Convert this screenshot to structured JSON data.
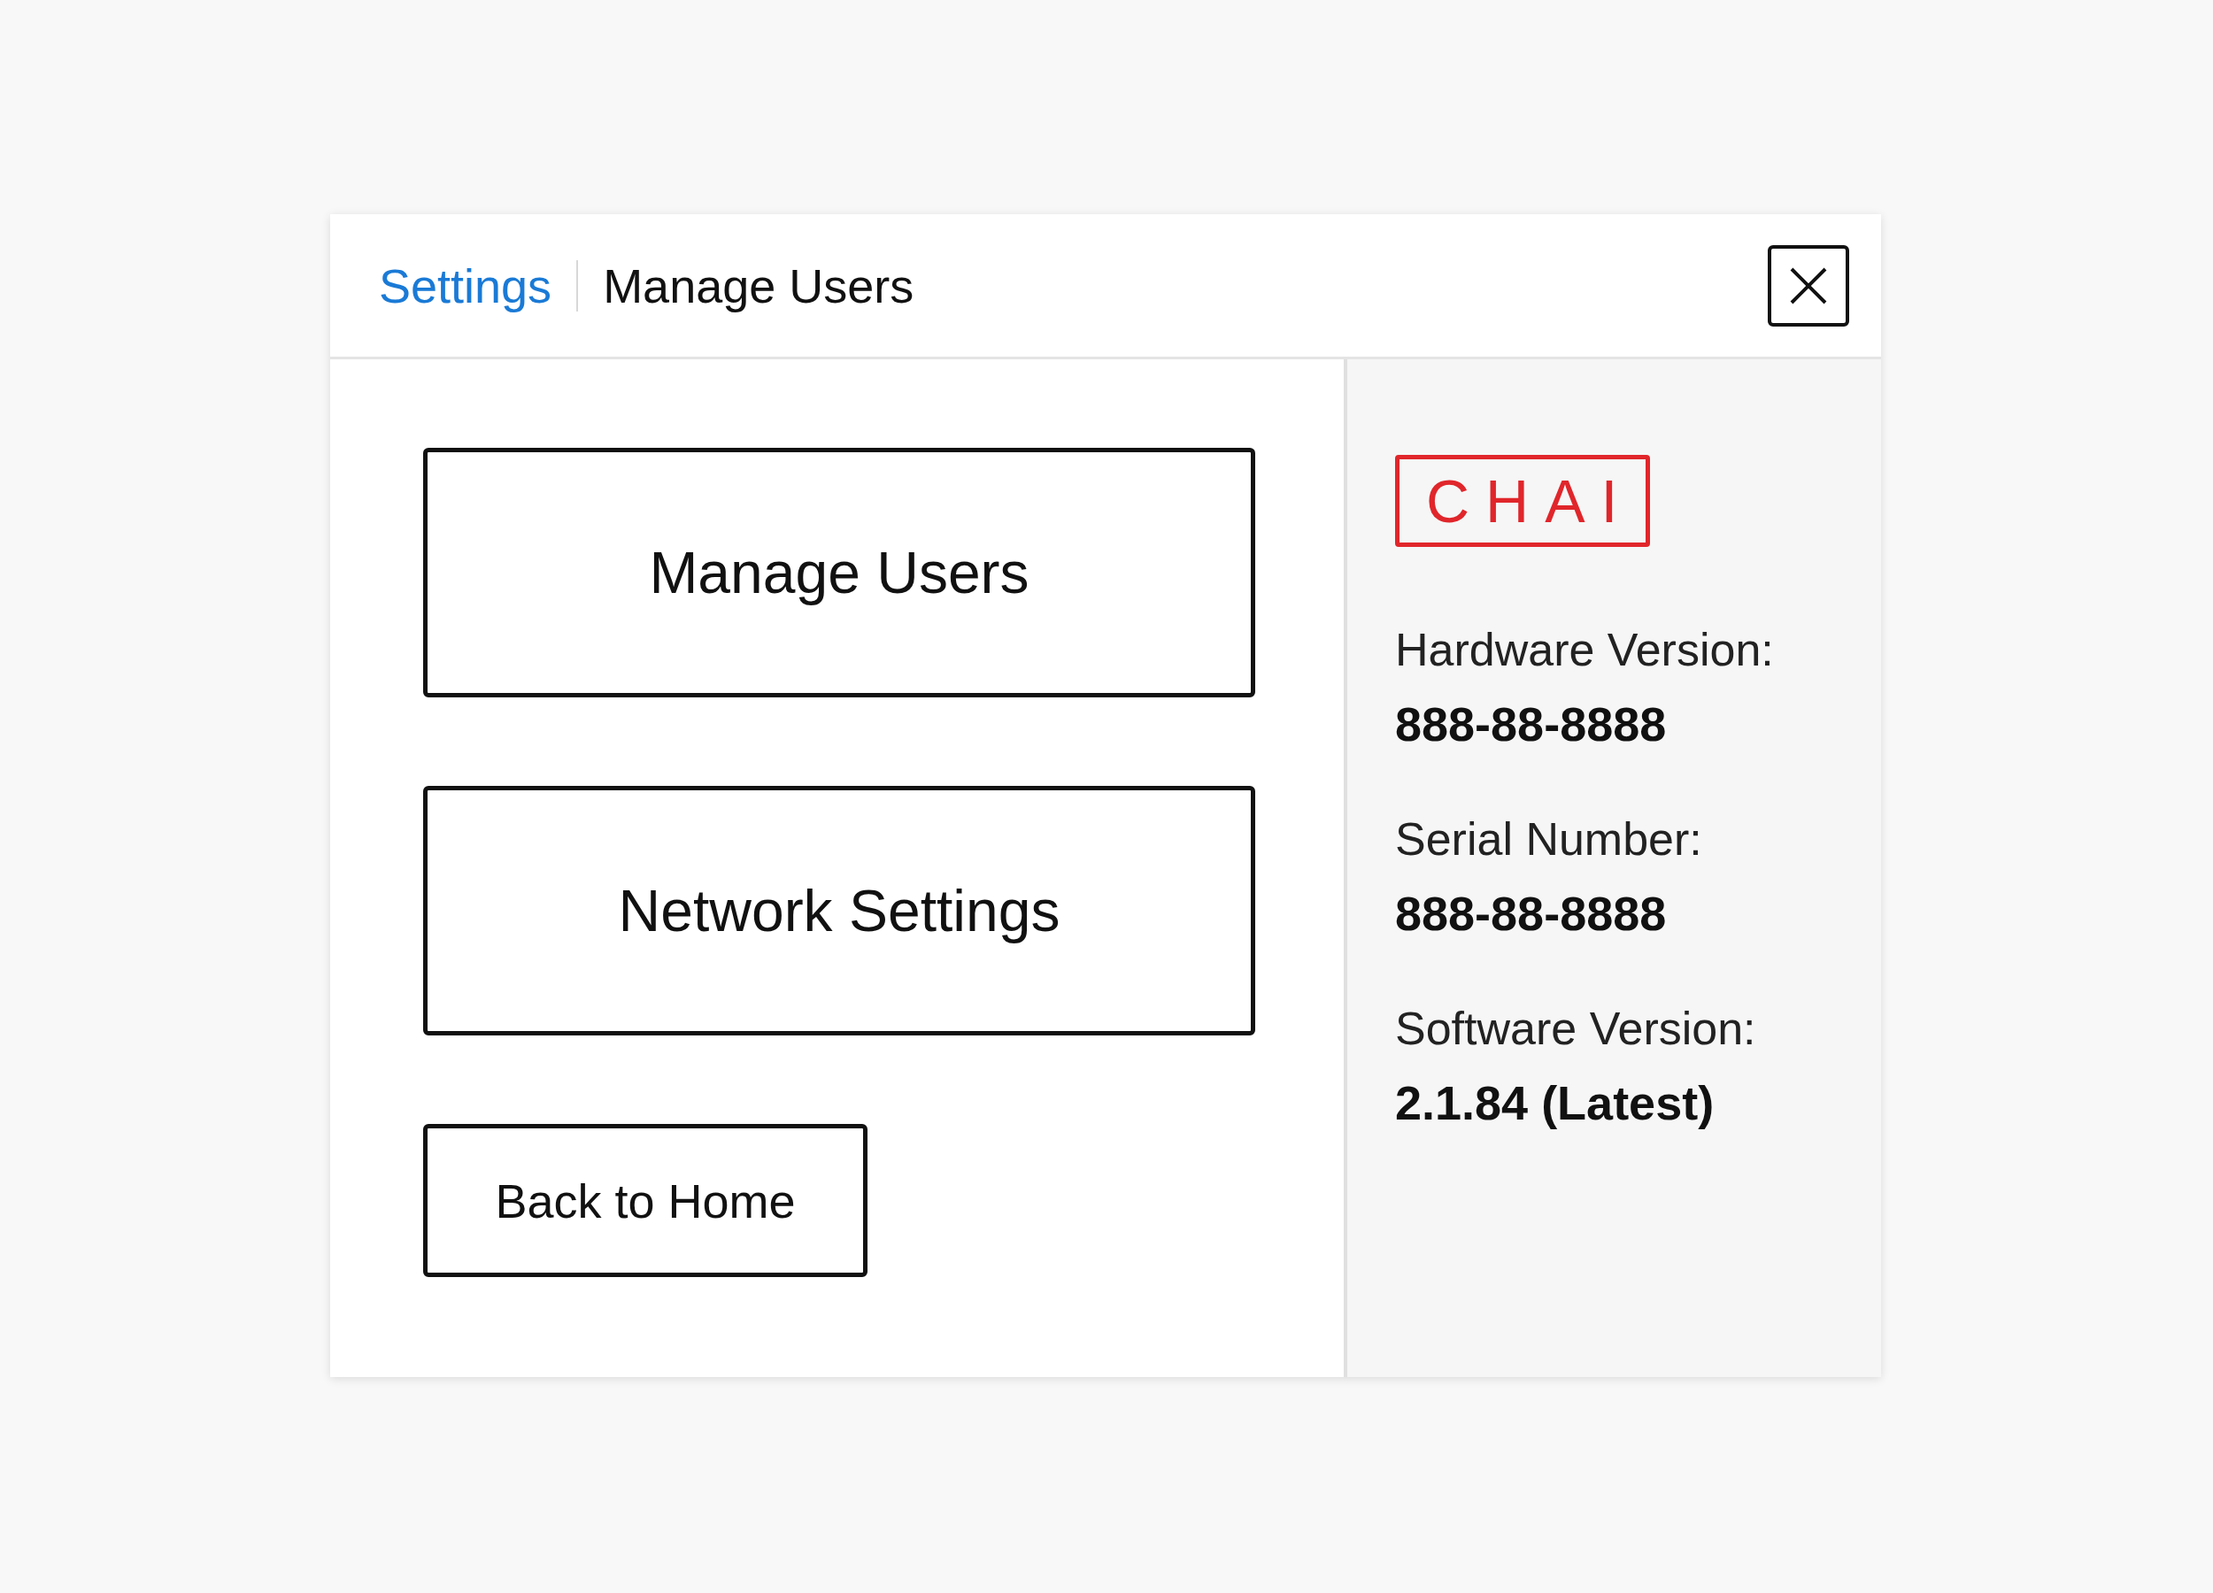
{
  "header": {
    "breadcrumb": [
      {
        "label": "Settings",
        "kind": "link"
      },
      {
        "label": "Manage Users",
        "kind": "current"
      }
    ]
  },
  "menu": {
    "buttons": [
      {
        "label": "Manage Users",
        "kind": "large"
      },
      {
        "label": "Network Settings",
        "kind": "large"
      },
      {
        "label": "Back to Home",
        "kind": "small"
      }
    ]
  },
  "info": {
    "logo": "CHAI",
    "items": [
      {
        "label": "Hardware Version:",
        "value": "888-88-8888"
      },
      {
        "label": "Serial Number:",
        "value": "888-88-8888"
      },
      {
        "label": "Software Version:",
        "value": "2.1.84 (Latest)"
      }
    ]
  }
}
